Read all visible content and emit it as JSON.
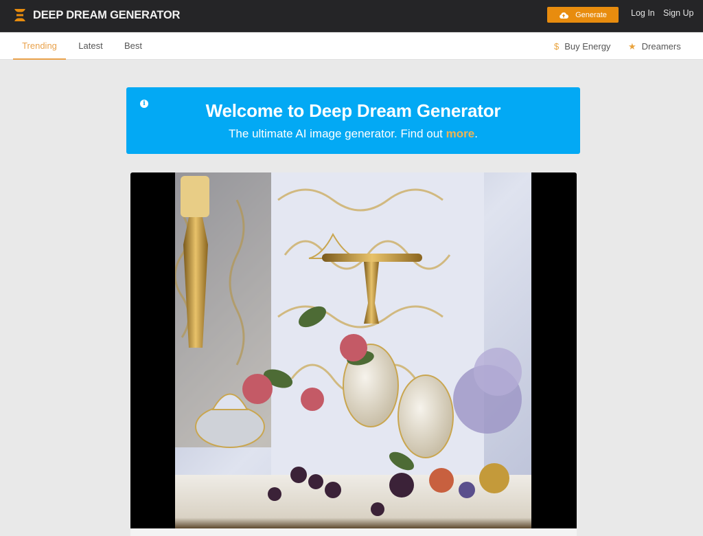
{
  "header": {
    "logo_icon": "hourglass-stack-icon",
    "brand": "DEEP DREAM GENERATOR",
    "generate_button": {
      "label": "Generate",
      "icon": "cloud-upload-icon"
    },
    "login": "Log In",
    "signup": "Sign Up"
  },
  "subnav": {
    "tabs": [
      {
        "label": "Trending",
        "active": true
      },
      {
        "label": "Latest",
        "active": false
      },
      {
        "label": "Best",
        "active": false
      }
    ],
    "right_links": [
      {
        "label": "Buy Energy",
        "icon": "dollar-icon",
        "glyph": "$"
      },
      {
        "label": "Dreamers",
        "icon": "star-icon",
        "glyph": "★"
      }
    ]
  },
  "banner": {
    "icon": "info-icon",
    "icon_glyph": "i",
    "title": "Welcome to Deep Dream Generator",
    "subtitle_prefix": "The ultimate AI image generator. Find out ",
    "subtitle_link": "more",
    "subtitle_suffix": "."
  },
  "feed": {
    "items": [
      {
        "description": "Ornate still life: white and gold baroque filigree wall, golden candle sconce, porcelain vases and lidded urn, red hydrangea flowers, blackberries, apples and glass on a white table"
      }
    ]
  },
  "colors": {
    "topbar_bg": "#252527",
    "accent_orange": "#e88c0e",
    "tab_active": "#e9a14a",
    "banner_blue": "#03a9f4",
    "banner_link": "#f0b453",
    "page_bg": "#e9e9e9"
  }
}
